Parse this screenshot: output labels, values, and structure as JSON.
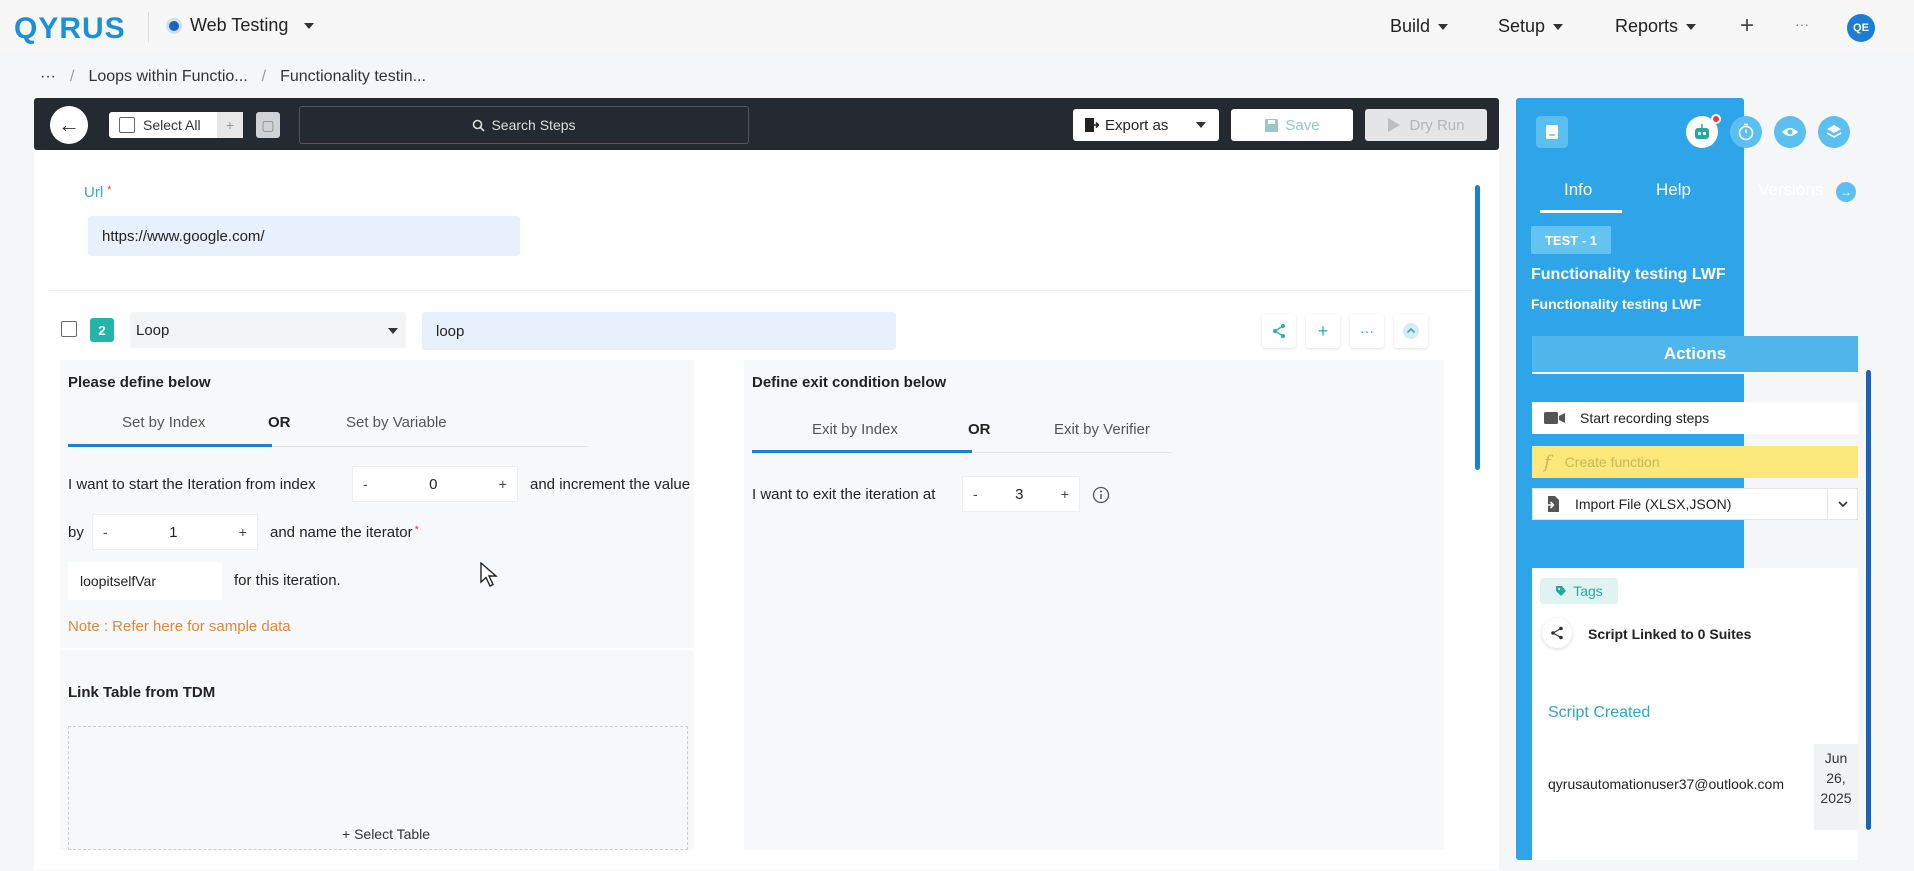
{
  "topnav": {
    "logo": "QYRUS",
    "project": "Web Testing",
    "menu": [
      "Build",
      "Setup",
      "Reports"
    ],
    "plus": "+",
    "more": "···",
    "avatar": "QE"
  },
  "breadcrumb": {
    "more": "···",
    "items": [
      "Loops within Functio...",
      "Functionality testin..."
    ]
  },
  "toolbar": {
    "select_all": "Select All",
    "search_placeholder": "Search Steps",
    "export_as": "Export as",
    "save": "Save",
    "dry_run": "Dry Run"
  },
  "url_step": {
    "label": "Url",
    "required": "*",
    "value": "https://www.google.com/"
  },
  "step2": {
    "number": "2",
    "action": "Loop",
    "name": "loop"
  },
  "left_panel": {
    "title": "Please define below",
    "tab_index": "Set by Index",
    "or": "OR",
    "tab_variable": "Set by Variable",
    "line1_pre": "I want to start the Iteration from index",
    "start_index": "0",
    "line1_post": "and increment the value",
    "by": "by",
    "increment": "1",
    "line2_post": "and name the iterator",
    "iterator_name": "loopitselfVar",
    "line3_post": "for this iteration.",
    "note": "Note : Refer here for sample data",
    "link_title": "Link Table from TDM",
    "select_table": "+ Select Table",
    "minus": "-",
    "plus": "+"
  },
  "right_panel": {
    "title": "Define exit condition below",
    "tab_index": "Exit by Index",
    "or": "OR",
    "tab_verifier": "Exit by Verifier",
    "line": "I want to exit the iteration at",
    "exit_index": "3"
  },
  "sidebar": {
    "tabs": [
      "Info",
      "Help",
      "Versions"
    ],
    "test_tag": "TEST - 1",
    "title": "Functionality testing LWF",
    "subtitle": "Functionality testing LWF",
    "actions_header": "Actions",
    "start_recording": "Start recording steps",
    "create_function": "Create function",
    "import_file": "Import File (XLSX,JSON)",
    "tags": "Tags",
    "linked": "Script Linked to 0 Suites",
    "script_created": "Script Created",
    "email": "qyrusautomationuser37@outlook.com",
    "date_lines": [
      "Jun",
      "26,",
      "2025"
    ]
  },
  "colors": {
    "accent": "#1c7fd0",
    "sidebar": "#2ea5e8",
    "teal": "#23b6a8",
    "toolbar": "#242a30"
  }
}
